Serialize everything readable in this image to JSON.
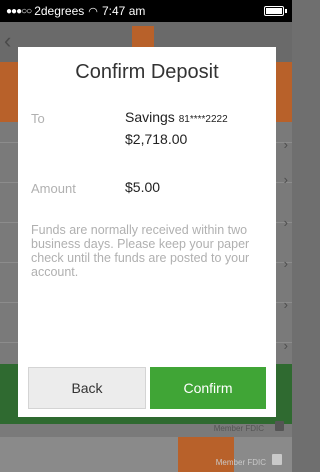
{
  "status_bar": {
    "signal": "●●●○○",
    "carrier": "2degrees",
    "wifi": "◠",
    "time": "7:47 am"
  },
  "background": {
    "back_glyph": "‹",
    "chevron_glyph": "›",
    "fdic_text": "Member FDIC"
  },
  "modal": {
    "title": "Confirm Deposit",
    "to_label": "To",
    "account_name": "Savings",
    "account_mask": "81****2222",
    "balance": "$2,718.00",
    "amount_label": "Amount",
    "amount_value": "$5.00",
    "notice": "Funds are normally received within two business days. Please keep your paper check until the funds are posted to your account.",
    "back_label": "Back",
    "confirm_label": "Confirm"
  },
  "colors": {
    "confirm_green": "#40a536",
    "brand_orange": "#b8612a"
  }
}
